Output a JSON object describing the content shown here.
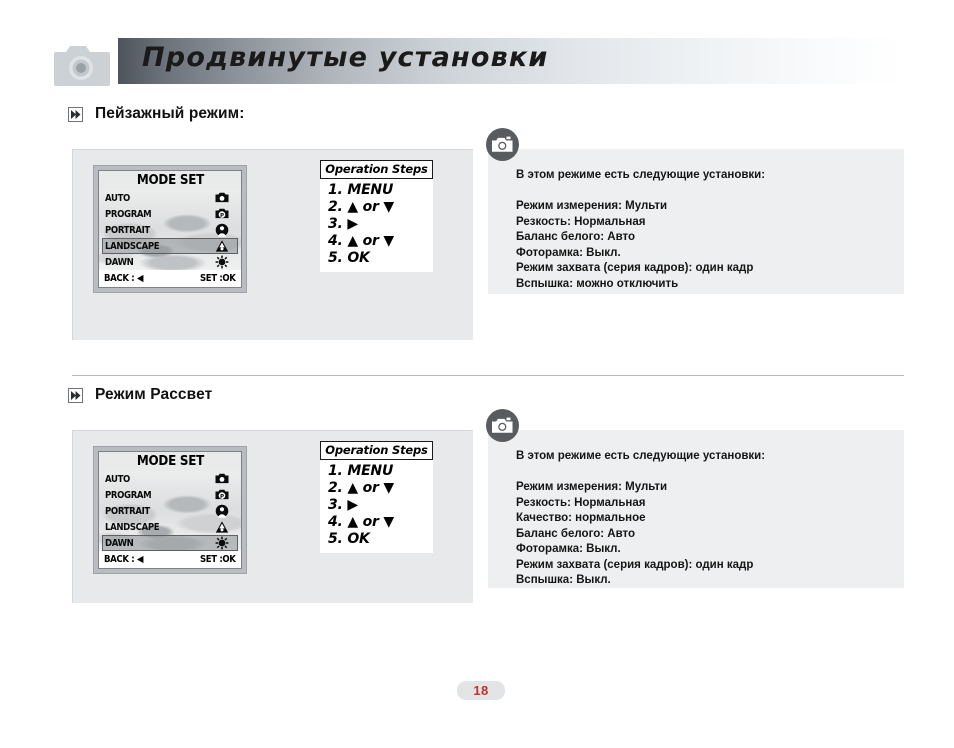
{
  "header": {
    "title": "Продвинутые установки",
    "camera_icon": "camera-icon"
  },
  "sections": [
    {
      "id": "landscape",
      "heading": "Пейзажный режим:",
      "marker_icon": "double-chevron-icon",
      "lcd": {
        "title": "MODE SET",
        "rows": [
          {
            "label": "AUTO",
            "icon": "camera-auto-icon",
            "selected": false
          },
          {
            "label": "PROGRAM",
            "icon": "camera-program-icon",
            "selected": false
          },
          {
            "label": "PORTRAIT",
            "icon": "portrait-head-icon",
            "selected": false
          },
          {
            "label": "LANDSCAPE",
            "icon": "mountain-icon",
            "selected": true
          },
          {
            "label": "DAWN",
            "icon": "sun-icon",
            "selected": false
          }
        ],
        "bottom_left": "BACK : ◀",
        "bottom_right": "SET :OK"
      },
      "operation_steps": {
        "heading": "Operation Steps",
        "lines": [
          "1. MENU",
          "2. ▲ or ▼",
          "3. ▶",
          "4. ▲ or ▼",
          "5. OK"
        ]
      },
      "info": {
        "camera_icon": "circle-camera-icon",
        "lead": "В этом режиме есть следующие установки:",
        "items": [
          "Режим измерения: Мульти",
          "Резкость: Нормальная",
          "Баланс белого: Авто",
          "Фоторамка: Выкл.",
          "Режим захвата (серия кадров): один кадр",
          "Вспышка:  можно отключить"
        ]
      }
    },
    {
      "id": "dawn",
      "heading": "Режим Рассвет",
      "marker_icon": "double-chevron-icon",
      "lcd": {
        "title": "MODE SET",
        "rows": [
          {
            "label": "AUTO",
            "icon": "camera-auto-icon",
            "selected": false
          },
          {
            "label": "PROGRAM",
            "icon": "camera-program-icon",
            "selected": false
          },
          {
            "label": "PORTRAIT",
            "icon": "portrait-head-icon",
            "selected": false
          },
          {
            "label": "LANDSCAPE",
            "icon": "mountain-icon",
            "selected": false
          },
          {
            "label": "DAWN",
            "icon": "sun-icon",
            "selected": true
          }
        ],
        "bottom_left": "BACK : ◀",
        "bottom_right": "SET :OK"
      },
      "operation_steps": {
        "heading": "Operation Steps",
        "lines": [
          "1. MENU",
          "2. ▲ or ▼",
          "3. ▶",
          "4. ▲ or ▼",
          "5. OK"
        ]
      },
      "info": {
        "camera_icon": "circle-camera-icon",
        "lead": "В этом режиме есть следующие установки:",
        "items": [
          "Режим измерения: Мульти",
          "Резкость: Нормальная",
          "Качество: нормальное",
          "Баланс белого: Авто",
          "Фоторамка: Выкл.",
          "Режим захвата (серия кадров): один кадр",
          "Вспышка:  Выкл."
        ]
      }
    }
  ],
  "footer": {
    "page_number": "18"
  },
  "colors": {
    "page_number": "#c2302b",
    "panel_gray": "#e8e9ea",
    "info_gray": "#eeeff0",
    "banner_dark": "#4e545c"
  }
}
